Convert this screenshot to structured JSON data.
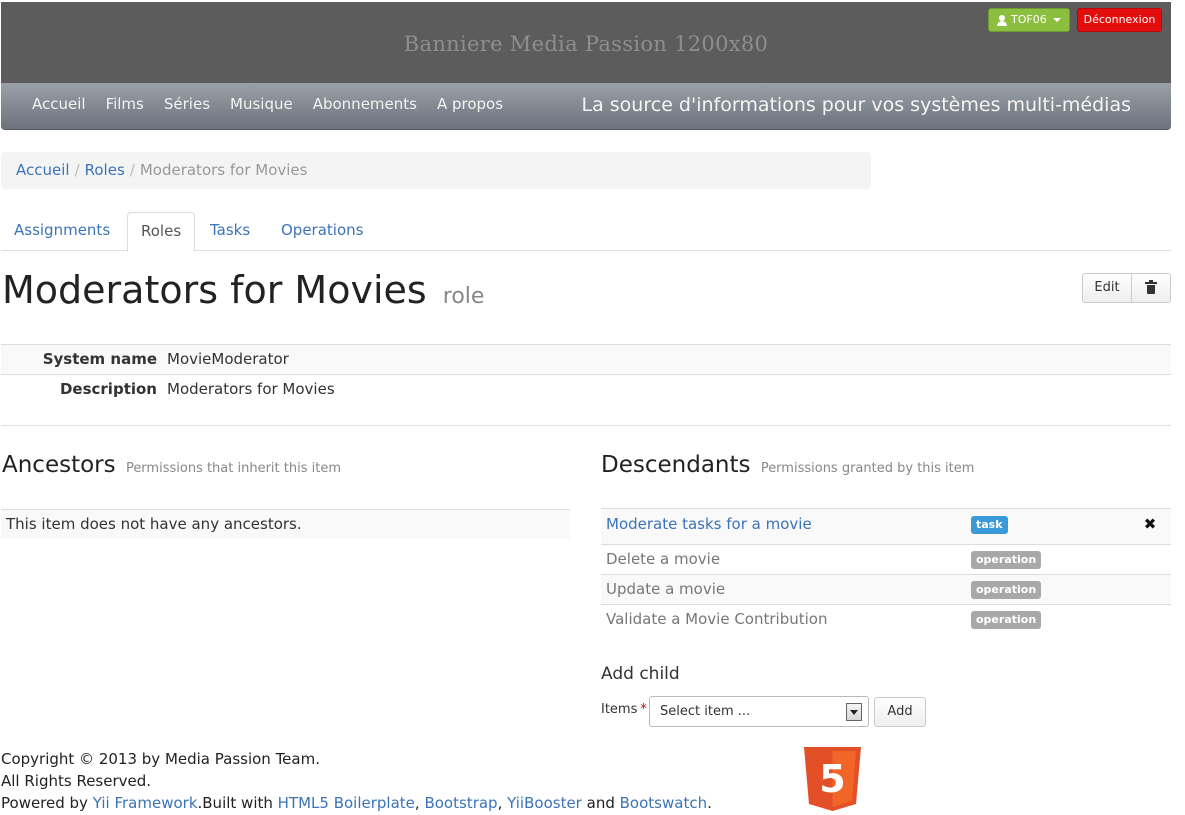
{
  "banner": {
    "title": "Banniere Media Passion 1200x80",
    "user_label": "TOF06",
    "logout_label": "Déconnexion"
  },
  "nav": {
    "items": [
      "Accueil",
      "Films",
      "Séries",
      "Musique",
      "Abonnements",
      "A propos"
    ],
    "tagline": "La source d'informations pour vos systèmes multi-médias"
  },
  "breadcrumb": {
    "items": [
      "Accueil",
      "Roles"
    ],
    "separator": "/",
    "active": "Moderators for Movies"
  },
  "tabs": [
    "Assignments",
    "Roles",
    "Tasks",
    "Operations"
  ],
  "page": {
    "title": "Moderators for Movies",
    "subtitle": "role",
    "edit_label": "Edit"
  },
  "details": {
    "system_name_label": "System name",
    "system_name_value": "MovieModerator",
    "description_label": "Description",
    "description_value": "Moderators for Movies"
  },
  "ancestors": {
    "title": "Ancestors",
    "subtitle": "Permissions that inherit this item",
    "empty_text": "This item does not have any ancestors."
  },
  "descendants": {
    "title": "Descendants",
    "subtitle": "Permissions granted by this item",
    "rows": [
      {
        "name": "Moderate tasks for a movie",
        "type": "task"
      },
      {
        "name": "Delete a movie",
        "type": "operation"
      },
      {
        "name": "Update a movie",
        "type": "operation"
      },
      {
        "name": "Validate a Movie Contribution",
        "type": "operation"
      }
    ]
  },
  "add_child": {
    "title": "Add child",
    "items_label": "Items",
    "required_mark": "*",
    "select_value": "Select item ...",
    "add_label": "Add"
  },
  "footer": {
    "line1": "Copyright © 2013 by Media Passion Team.",
    "line2": "All Rights Reserved.",
    "powered_by": "Powered by",
    "yii": "Yii Framework",
    "built_with": ".Built with",
    "h5bp": "HTML5 Boilerplate",
    "comma1": ",",
    "bootstrap": "Bootstrap",
    "comma2": ",",
    "yiibooster": "YiiBooster",
    "and": "and",
    "bootswatch": "Bootswatch",
    "period": ".",
    "html5_badge": "5"
  },
  "colors": {
    "banner_bg": "#5c5c5c",
    "user_btn": "#8cbf3f",
    "logout_btn": "#e20d0d",
    "link": "#3b73b9",
    "task_label": "#3a9ad9",
    "operation_label": "#a8a8a8",
    "html5_orange": "#e34f26"
  }
}
